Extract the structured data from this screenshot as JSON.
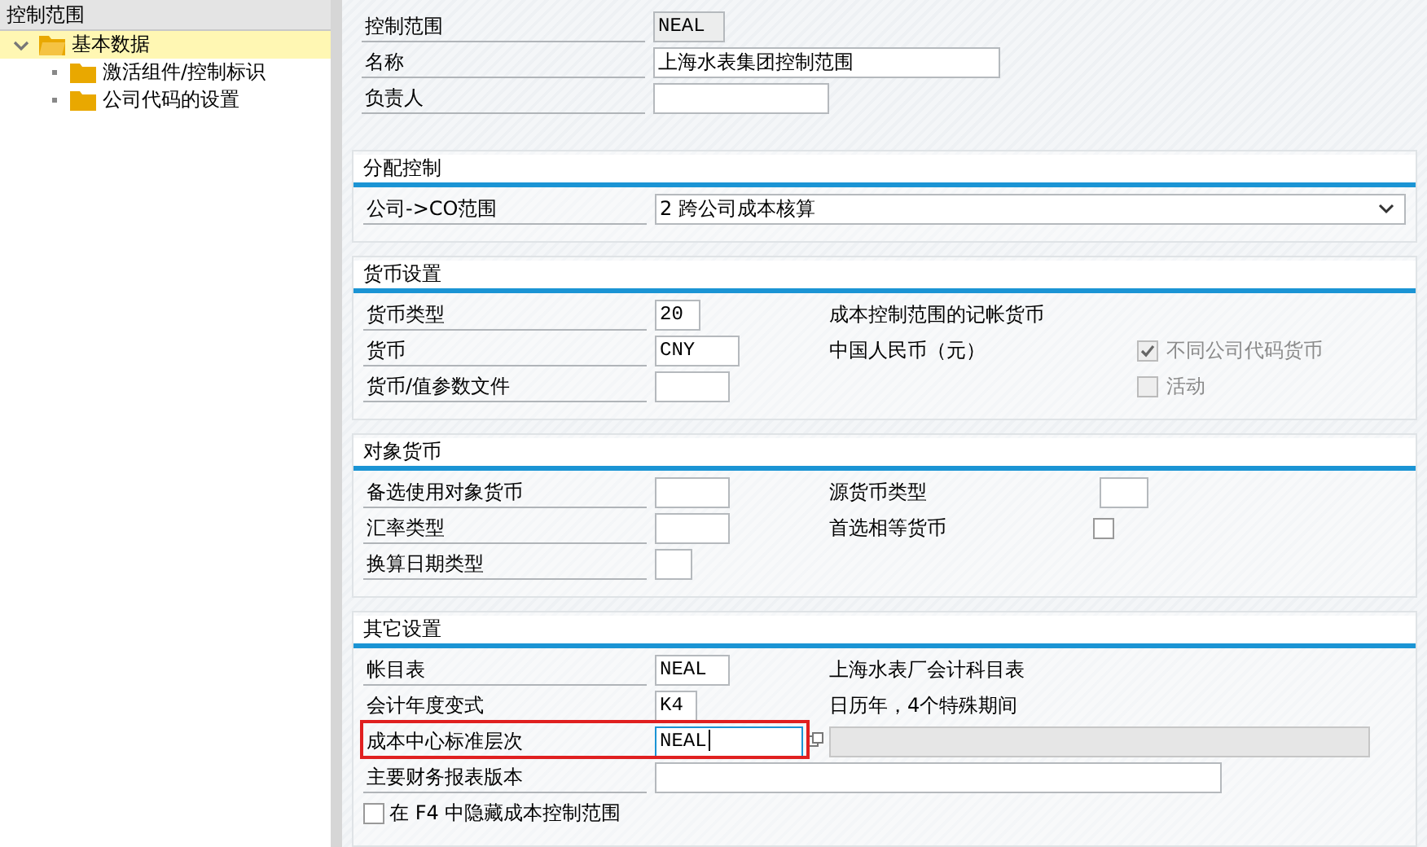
{
  "sidebar": {
    "title": "控制范围",
    "tree": [
      {
        "label": "基本数据",
        "expanded": true,
        "selected": true,
        "children": [
          {
            "label": "激活组件/控制标识",
            "selected": false
          },
          {
            "label": "公司代码的设置",
            "selected": false
          }
        ]
      }
    ]
  },
  "header_fields": [
    {
      "kind": "readonly",
      "label": "控制范围",
      "value": "NEAL"
    },
    {
      "kind": "field",
      "label": "名称",
      "value": "上海水表集团控制范围"
    },
    {
      "kind": "field",
      "label": "负责人"
    }
  ],
  "sections": [
    {
      "title": "分配控制",
      "rows": [
        {
          "kind": "dropdown",
          "label": "公司->CO范围",
          "value": "2 跨公司成本核算"
        }
      ]
    },
    {
      "title": "货币设置",
      "rows": [
        {
          "kind": "field",
          "label": "货币类型",
          "value": "20",
          "note": "成本控制范围的记帐货币"
        },
        {
          "kind": "field",
          "label": "货币",
          "value": "CNY",
          "note": "中国人民币（元）",
          "option": {
            "label": "不同公司代码货币",
            "checked": true,
            "disabled": true
          }
        },
        {
          "kind": "field",
          "label": "货币/值参数文件",
          "option": {
            "label": "活动",
            "checked": false,
            "disabled": true
          }
        }
      ]
    },
    {
      "title": "对象货币",
      "rows": [
        {
          "kind": "field",
          "label": "备选使用对象货币",
          "right": {
            "kind": "field",
            "label": "源货币类型"
          }
        },
        {
          "kind": "field",
          "label": "汇率类型",
          "right": {
            "kind": "check",
            "label": "首选相等货币",
            "checked": false
          }
        },
        {
          "kind": "field",
          "label": "换算日期类型"
        }
      ]
    },
    {
      "title": "其它设置",
      "rows": [
        {
          "kind": "field",
          "label": "帐目表",
          "value": "NEAL",
          "note": "上海水表厂会计科目表"
        },
        {
          "kind": "field",
          "label": "会计年度变式",
          "value": "K4",
          "note": "日历年，4个特殊期间"
        },
        {
          "kind": "search",
          "label": "成本中心标准层次",
          "value": "NEAL",
          "focused": true,
          "highlighted": true
        },
        {
          "kind": "field",
          "label": "主要财务报表版本"
        },
        {
          "kind": "check",
          "label": "在 F4 中隐藏成本控制范围",
          "checked": false
        }
      ]
    }
  ]
}
